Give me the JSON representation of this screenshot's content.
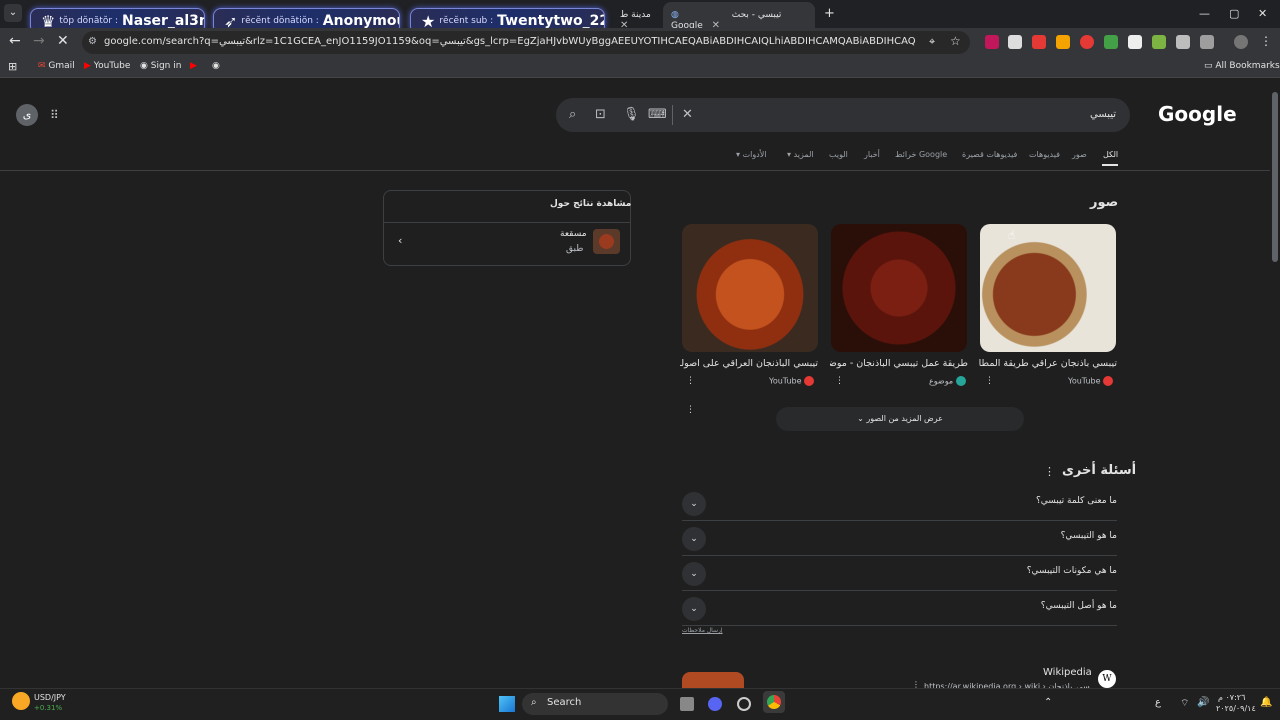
{
  "browser": {
    "tabs": [
      {
        "label": "مدينة ط",
        "close": "✕",
        "active": false
      },
      {
        "label": "تيبسي - بحث Google",
        "close": "✕",
        "active": true
      }
    ],
    "new_tab": "+",
    "tab_overflow": "⌄",
    "window_controls": [
      "—",
      "▢",
      "✕"
    ],
    "url": "google.com/search?q=تيبسي&rlz=1C1GCEA_enJO1159JO1159&oq=تيبسي&gs_lcrp=EgZjaHJvbWUyBggAEEUYOTIHCAEQABiABDIHCAIQLhiABDIHCAMQABiABDIHCAQQABiABDIHCAUQABiABDIJCAYQ...",
    "bookmarks": [
      "Gmail",
      "YouTube",
      "Sign in"
    ],
    "all_bookmarks": "All Bookmarks"
  },
  "stream_banners": [
    {
      "prefix": "tŏp dŏnătŏr :",
      "name": "Naser_al3nzy"
    },
    {
      "prefix": "rĕcĕnt dŏnătiŏn :",
      "name": "Anonymous"
    },
    {
      "prefix": "rĕcĕnt sub :",
      "name": "Twentytwo_22"
    }
  ],
  "google": {
    "logo": "Google",
    "query": "تيبسي",
    "avatar_letter": "ى",
    "nav_tabs": [
      "الكل",
      "صور",
      "فيديوهات",
      "فيديوهات قصيرة",
      "خرائط Google",
      "أخبار",
      "الويب",
      "المزيد",
      "الأدوات"
    ],
    "images_heading": "صور",
    "images": [
      {
        "caption": "تيبسي باذنجان عراقي طريقة المطاع...",
        "source": "YouTube",
        "source_color": "#e53935"
      },
      {
        "caption": "طريقة عمل تيبسي الباذنجان - موضوع",
        "source": "موضوع",
        "source_color": "#26a69a"
      },
      {
        "caption": "تيبسي الباذنجان العراقي على اصوله",
        "source": "YouTube",
        "source_color": "#e53935"
      }
    ],
    "more_images": "عرض المزيد من الصور",
    "paa_heading": "أسئلة أخرى",
    "questions": [
      "ما معنى كلمة تيبسي؟",
      "ما هو التيبسي؟",
      "ما هي مكونات التيبسي؟",
      "ما هو أصل التيبسي؟"
    ],
    "feedback": "إرسال ملاحظات",
    "wiki_title": "Wikipedia",
    "wiki_url": "https://ar.wikipedia.org › wiki › تيبسي_باذنجان",
    "side_panel": {
      "title": "مشاهدة نتائج حول",
      "item_title": "مسقعة",
      "item_sub": "طبق"
    }
  },
  "taskbar": {
    "ticker": "USD/JPY",
    "ticker_change": "+0.31%",
    "search": "Search",
    "time": "٠٧:٢٦ م",
    "date": "٢٠٢٥/٠٩/١٤",
    "lang": "ع"
  },
  "colors": {
    "accent": "#8ab4f8",
    "bg": "#1f1f1f"
  }
}
